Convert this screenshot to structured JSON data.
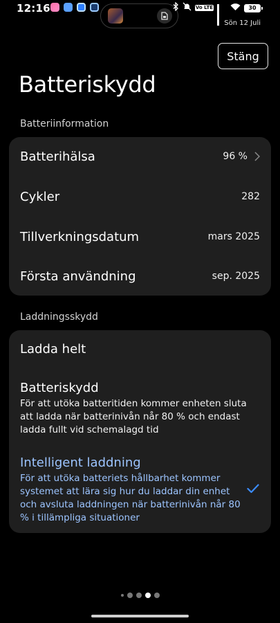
{
  "status_bar": {
    "time": "12:16",
    "date": "Sön 12 Juli",
    "volte": "Vo LTE",
    "battery_level": "30",
    "notification_icons": [
      "app-icon-pink",
      "app-icon-blue",
      "app-icon-blue-outline",
      "app-icon-navy"
    ],
    "system_icons": [
      "bluetooth-icon",
      "mute-icon",
      "volte-icon",
      "signal-icon",
      "wifi-icon",
      "battery-icon"
    ]
  },
  "header": {
    "close_label": "Stäng",
    "title": "Batteriskydd"
  },
  "battery_info": {
    "section_label": "Batteriinformation",
    "rows": [
      {
        "label": "Batterihälsa",
        "value": "96 %"
      },
      {
        "label": "Cykler",
        "value": "282"
      },
      {
        "label": "Tillverkningsdatum",
        "value": "mars 2025"
      },
      {
        "label": "Första användning",
        "value": "sep. 2025"
      }
    ]
  },
  "charging": {
    "section_label": "Laddningsskydd",
    "options": [
      {
        "title": "Ladda helt",
        "description": "",
        "selected": false
      },
      {
        "title": "Batteriskydd",
        "description": "För att utöka batteritiden kommer enheten sluta att ladda när batterinivån når 80 % och endast ladda fullt vid schemalagd tid",
        "selected": false
      },
      {
        "title": "Intelligent laddning",
        "description": "För att utöka batteriets hållbarhet kommer systemet att lära sig hur du laddar din enhet och avsluta laddningen när batterinivån når 80 % i tillämpliga situationer",
        "selected": true
      }
    ]
  },
  "pager": {
    "total": 4,
    "active": 3
  },
  "colors": {
    "background": "#000000",
    "card": "#1f1f1f",
    "accent": "#9cc4ff"
  }
}
